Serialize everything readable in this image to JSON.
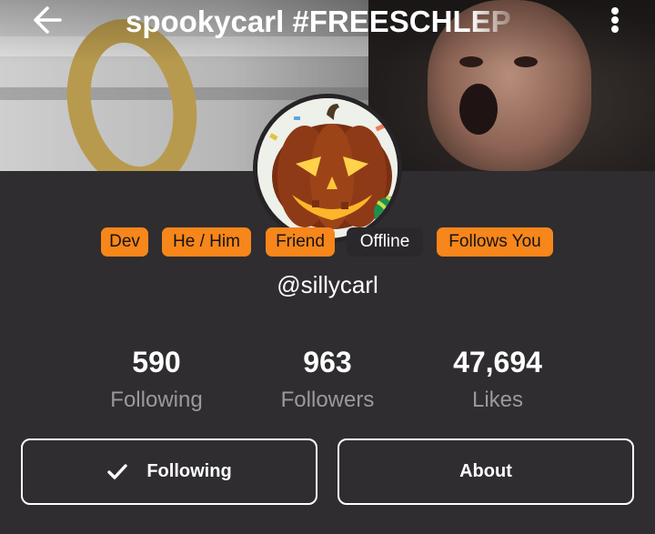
{
  "header": {
    "title": "spookycarl #FREESCHLEP",
    "back_icon": "arrow-left-icon",
    "more_icon": "more-vertical-icon"
  },
  "avatar": {
    "icon": "jack-o-lantern-avatar"
  },
  "badges": [
    {
      "label": "Dev"
    },
    {
      "label": "He / Him"
    },
    {
      "label": "Friend"
    },
    {
      "label": "Offline"
    },
    {
      "label": "Follows You"
    }
  ],
  "profile": {
    "handle": "@sillycarl"
  },
  "stats": [
    {
      "value": "590",
      "label": "Following"
    },
    {
      "value": "963",
      "label": "Followers"
    },
    {
      "value": "47,694",
      "label": "Likes"
    }
  ],
  "actions": {
    "following_label": "Following",
    "following_icon": "checkmark-icon",
    "about_label": "About"
  },
  "colors": {
    "background": "#2f2d30",
    "badge": "#f7861b",
    "text": "#ffffff",
    "muted": "#9b999b"
  }
}
